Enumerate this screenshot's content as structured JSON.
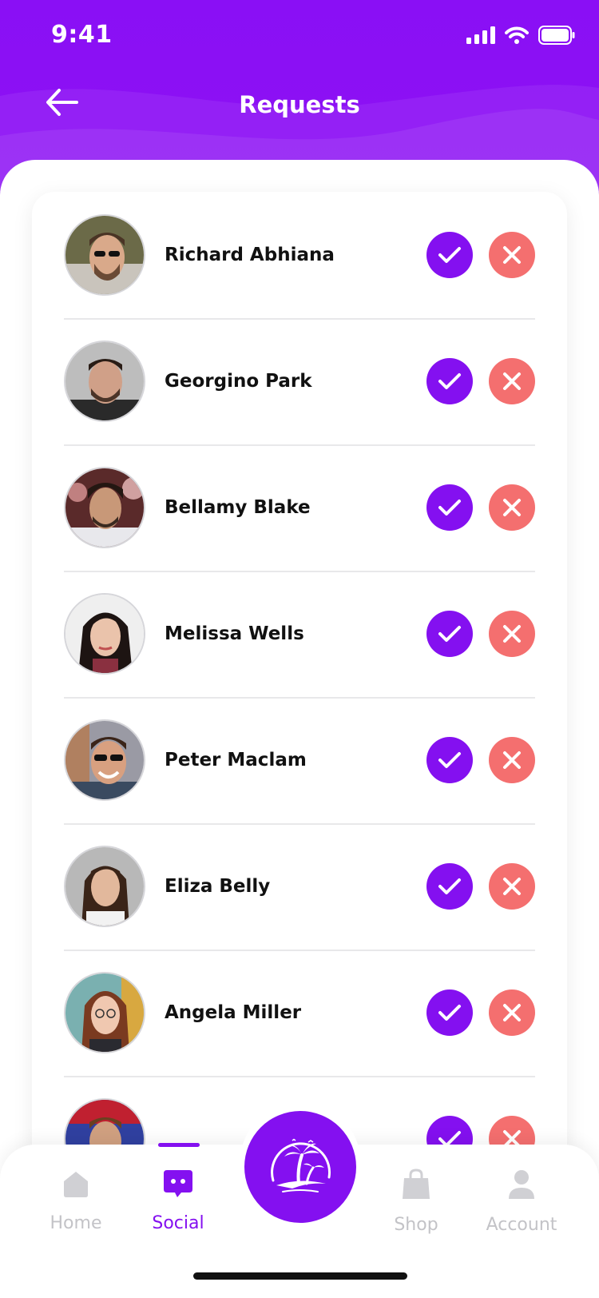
{
  "status_bar": {
    "time": "9:41"
  },
  "header": {
    "title": "Requests"
  },
  "requests": [
    {
      "name": "Richard Abhiana"
    },
    {
      "name": "Georgino Park"
    },
    {
      "name": "Bellamy Blake"
    },
    {
      "name": "Melissa Wells"
    },
    {
      "name": "Peter Maclam"
    },
    {
      "name": "Eliza Belly"
    },
    {
      "name": "Angela Miller"
    },
    {
      "name": ""
    }
  ],
  "tabbar": {
    "items": [
      {
        "label": "Home",
        "icon": "home-icon"
      },
      {
        "label": "Social",
        "icon": "chat-icon",
        "active": true
      },
      {
        "label": "Shop",
        "icon": "shopping-bag-icon"
      },
      {
        "label": "Account",
        "icon": "user-icon"
      }
    ],
    "center_icon": "palm-tree-logo-icon"
  },
  "colors": {
    "primary": "#8410f0",
    "decline": "#f46f6f",
    "inactive_tab": "#c3c3c7"
  }
}
